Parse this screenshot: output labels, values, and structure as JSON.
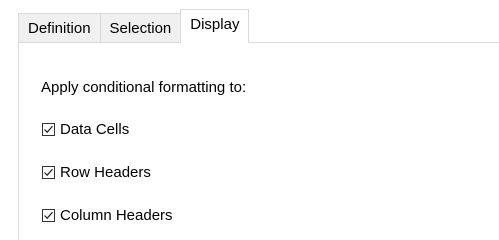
{
  "tabs": [
    {
      "label": "Definition",
      "active": false
    },
    {
      "label": "Selection",
      "active": false
    },
    {
      "label": "Display",
      "active": true
    }
  ],
  "display": {
    "caption": "Apply conditional formatting to:",
    "options": [
      {
        "label": "Data Cells",
        "checked": true
      },
      {
        "label": "Row Headers",
        "checked": true
      },
      {
        "label": "Column Headers",
        "checked": true
      }
    ]
  },
  "icons": {
    "checkmark": "checkmark-icon"
  }
}
